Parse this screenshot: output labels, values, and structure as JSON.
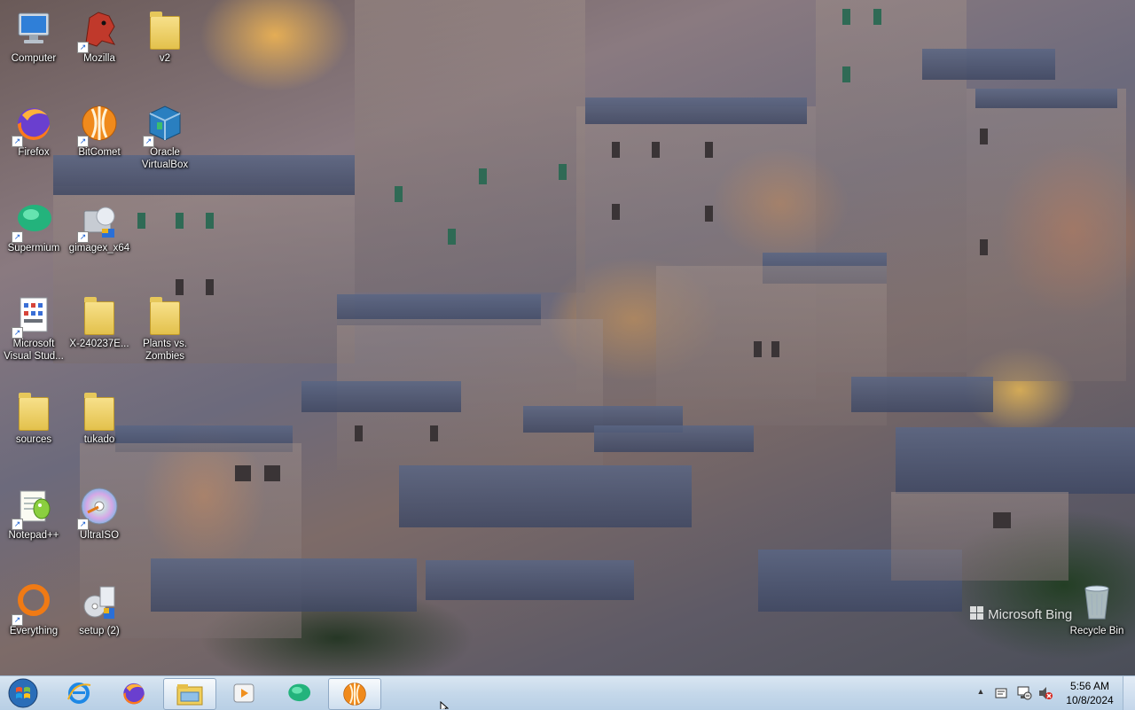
{
  "desktop": {
    "icons": [
      {
        "label": "Computer",
        "icon": "computer-icon"
      },
      {
        "label": "Mozilla",
        "icon": "mozilla-icon"
      },
      {
        "label": "v2",
        "icon": "folder-icon"
      },
      {
        "label": "Firefox",
        "icon": "firefox-icon"
      },
      {
        "label": "BitComet",
        "icon": "bitcomet-icon"
      },
      {
        "label": "Oracle\nVirtualBox",
        "icon": "virtualbox-icon"
      },
      {
        "label": "Supermium",
        "icon": "supermium-icon"
      },
      {
        "label": "gimagex_x64",
        "icon": "gimagex-icon"
      },
      {
        "label": "Microsoft\nVisual Stud...",
        "icon": "visual-studio-icon"
      },
      {
        "label": "X-240237E...",
        "icon": "folder-icon"
      },
      {
        "label": "Plants vs.\nZombies",
        "icon": "folder-icon"
      },
      {
        "label": "sources",
        "icon": "folder-icon"
      },
      {
        "label": "tukado",
        "icon": "folder-icon"
      },
      {
        "label": "Notepad++",
        "icon": "notepadpp-icon"
      },
      {
        "label": "UltraISO",
        "icon": "ultraiso-icon"
      },
      {
        "label": "Everything",
        "icon": "everything-icon"
      },
      {
        "label": "setup (2)",
        "icon": "setup-icon"
      },
      {
        "label": "Recycle Bin",
        "icon": "recycle-bin-icon"
      }
    ],
    "watermark": "Microsoft Bing"
  },
  "taskbar": {
    "pinned": [
      {
        "name": "start-button",
        "icon": "windows-logo-icon"
      },
      {
        "name": "internet-explorer",
        "icon": "internet-explorer-icon"
      },
      {
        "name": "firefox",
        "icon": "firefox-icon"
      },
      {
        "name": "explorer",
        "icon": "file-explorer-icon"
      },
      {
        "name": "media-player",
        "icon": "media-player-icon"
      },
      {
        "name": "supermium",
        "icon": "supermium-icon"
      },
      {
        "name": "bitcomet",
        "icon": "bitcomet-icon"
      }
    ],
    "clock": {
      "time": "5:56 AM",
      "date": "10/8/2024"
    }
  },
  "colors": {
    "taskbar": "#c5d8ea",
    "accent": "#1a5fd0"
  }
}
